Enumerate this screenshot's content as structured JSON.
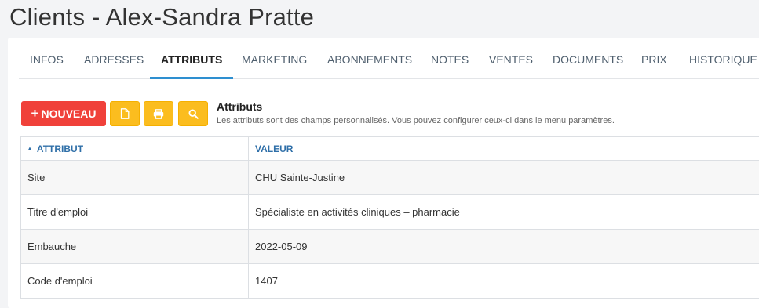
{
  "page": {
    "title": "Clients - Alex-Sandra Pratte"
  },
  "tabs": [
    {
      "label": "INFOS"
    },
    {
      "label": "ADRESSES"
    },
    {
      "label": "ATTRIBUTS",
      "active": true
    },
    {
      "label": "MARKETING"
    },
    {
      "label": "ABONNEMENTS"
    },
    {
      "label": "NOTES"
    },
    {
      "label": "VENTES"
    },
    {
      "label": "DOCUMENTS"
    },
    {
      "label": "PRIX"
    },
    {
      "label": "HISTORIQUE"
    }
  ],
  "toolbar": {
    "new_label": "NOUVEAU",
    "new_icon": "plus-icon",
    "icons": [
      "file-icon",
      "print-icon",
      "search-icon"
    ],
    "colors": {
      "new": "#f0413a",
      "secondary": "#fbbd1f",
      "accent": "#2e8fd0"
    }
  },
  "info": {
    "title": "Attributs",
    "description": "Les attributs sont des champs personnalisés. Vous pouvez configurer ceux-ci dans le menu paramètres."
  },
  "table": {
    "columns": [
      "ATTRIBUT",
      "VALEUR"
    ],
    "sort_column": "ATTRIBUT",
    "sort_direction": "asc",
    "rows": [
      {
        "attribut": "Site",
        "valeur": "CHU Sainte-Justine"
      },
      {
        "attribut": "Titre d'emploi",
        "valeur": "Spécialiste en activités cliniques – pharmacie"
      },
      {
        "attribut": "Embauche",
        "valeur": "2022-05-09"
      },
      {
        "attribut": "Code d'emploi",
        "valeur": "1407"
      }
    ]
  }
}
